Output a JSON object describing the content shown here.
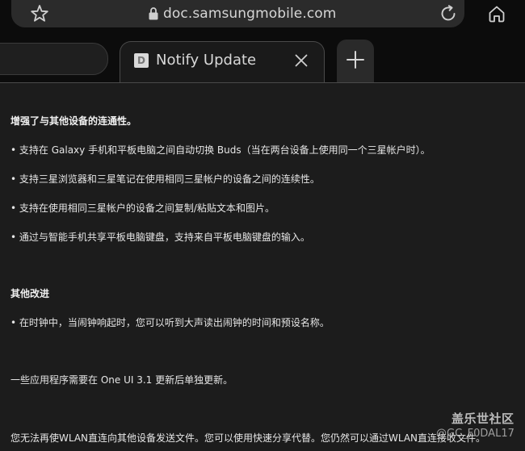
{
  "browser": {
    "url": "doc.samsungmobile.com",
    "icons": {
      "bookmark": "star-icon",
      "secure": "lock-icon",
      "reload": "reload-icon",
      "home": "home-icon",
      "close_tab": "close-icon",
      "new_tab": "plus-icon"
    }
  },
  "tabs": {
    "active": {
      "title": "Notify Update",
      "favicon_letter": "D"
    }
  },
  "content": {
    "lines": [
      "增强了与其他设备的连通性。",
      "• 支持在 Galaxy 手机和平板电脑之间自动切换 Buds（当在两台设备上使用同一个三星帐户时）。",
      "• 支持三星浏览器和三星笔记在使用相同三星帐户的设备之间的连续性。",
      "• 支持在使用相同三星帐户的设备之间复制/粘贴文本和图片。",
      "• 通过与智能手机共享平板电脑键盘，支持来自平板电脑键盘的输入。",
      "其他改进",
      "• 在时钟中，当闹钟响起时，您可以听到大声读出闹钟的时间和预设名称。",
      "一些应用程序需要在 One UI 3.1 更新后单独更新。",
      "您无法再使WLAN直连向其他设备发送文件。您可以使用快速分享代替。您仍然可以通过WLAN直连接收文件。"
    ]
  },
  "watermark": {
    "site": "盖乐世社区",
    "user": "@GC_F0DAL17"
  }
}
